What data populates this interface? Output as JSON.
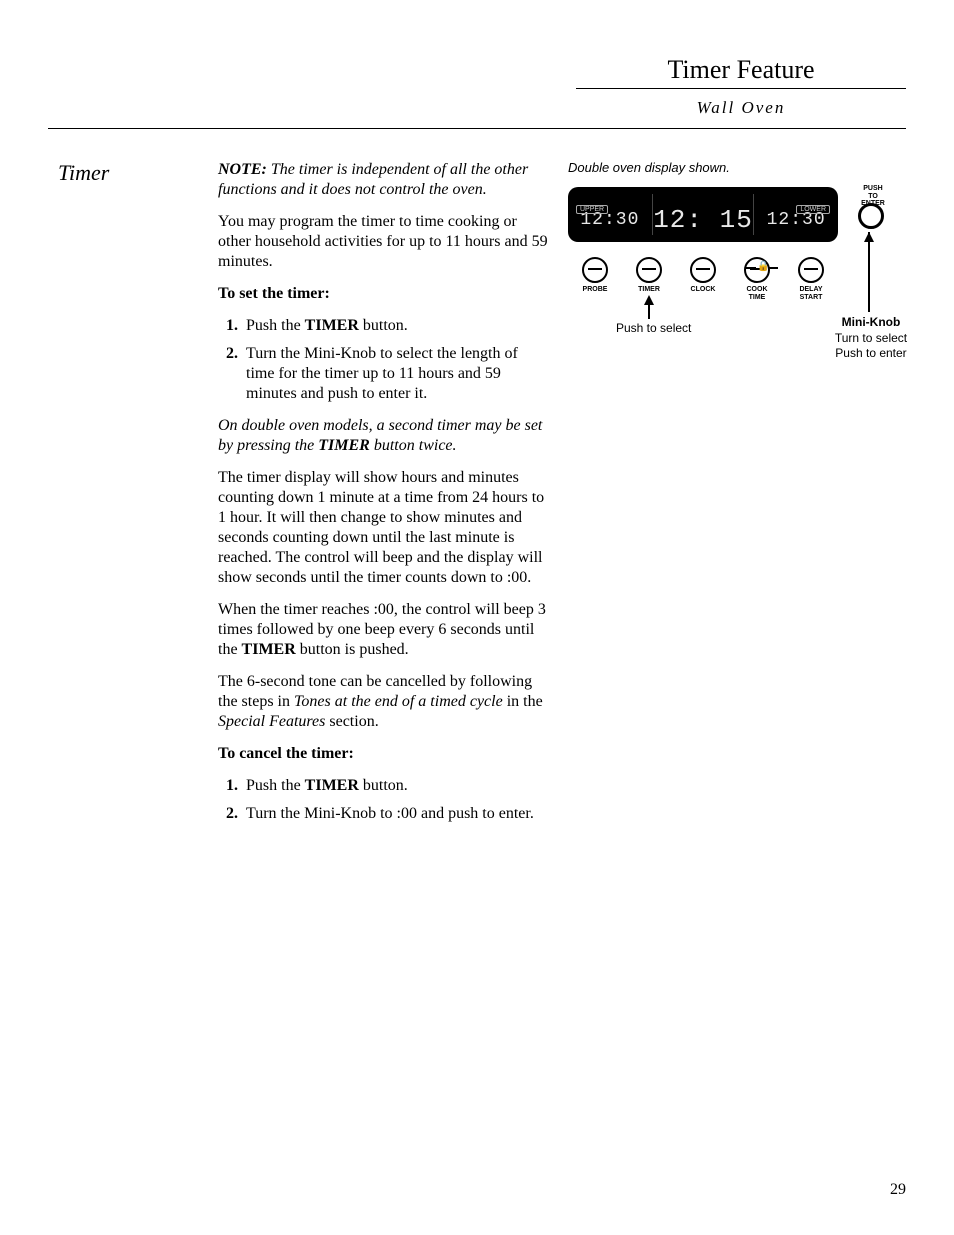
{
  "header": {
    "title": "Timer Feature",
    "subtitle": "Wall Oven"
  },
  "side_heading": "Timer",
  "body": {
    "note_label": "NOTE:",
    "note_text": " The timer is independent of all the other functions and it does not control the oven.",
    "p_intro": "You may program the timer to time cooking or other household activities for up to 11 hours and 59 minutes.",
    "set_heading": "To set the timer:",
    "set_steps": {
      "s1_a": "Push the ",
      "s1_b": "TIMER",
      "s1_c": " button.",
      "s2": "Turn the Mini-Knob to select the length of time for the timer up to 11 hours and 59 minutes and push to enter it."
    },
    "double_note_a": "On double oven models, a second timer may be set by pressing the ",
    "double_note_b": "TIMER",
    "double_note_c": " button twice.",
    "p_display": "The timer display will show hours and minutes counting down 1 minute at a time from 24 hours to 1 hour. It will then change to show minutes and seconds counting down until the last minute is reached. The control will beep and the display will show seconds until the timer counts down to :00.",
    "p_beep_a": "When the timer reaches :00, the control will beep 3 times followed by one beep every 6 seconds until the ",
    "p_beep_b": "TIMER",
    "p_beep_c": " button is pushed.",
    "p_tone_a": "The 6-second tone can be cancelled by following the steps in ",
    "p_tone_b": "Tones at the end of a timed cycle",
    "p_tone_c": " in the ",
    "p_tone_d": "Special Features",
    "p_tone_e": " section.",
    "cancel_heading": "To cancel the timer:",
    "cancel_steps": {
      "c1_a": "Push the ",
      "c1_b": "TIMER",
      "c1_c": " button.",
      "c2": "Turn the Mini-Knob to :00 and push to enter."
    }
  },
  "illustration": {
    "caption": "Double oven display shown.",
    "display": {
      "upper_tag": "UPPER",
      "lower_tag": "LOWER",
      "left_time": "12:30",
      "center_time": "12: 15",
      "right_time": "12:30"
    },
    "knob_top_label": "PUSH\nTO\nENTER",
    "buttons": {
      "b1": "PROBE",
      "b2": "TIMER",
      "b3": "CLOCK",
      "b4": "COOK\nTIME",
      "b5": "DELAY\nSTART"
    },
    "push_label": "Push to select",
    "mini_title": "Mini-Knob",
    "mini_l1": "Turn to select",
    "mini_l2": "Push to enter"
  },
  "page_number": "29"
}
